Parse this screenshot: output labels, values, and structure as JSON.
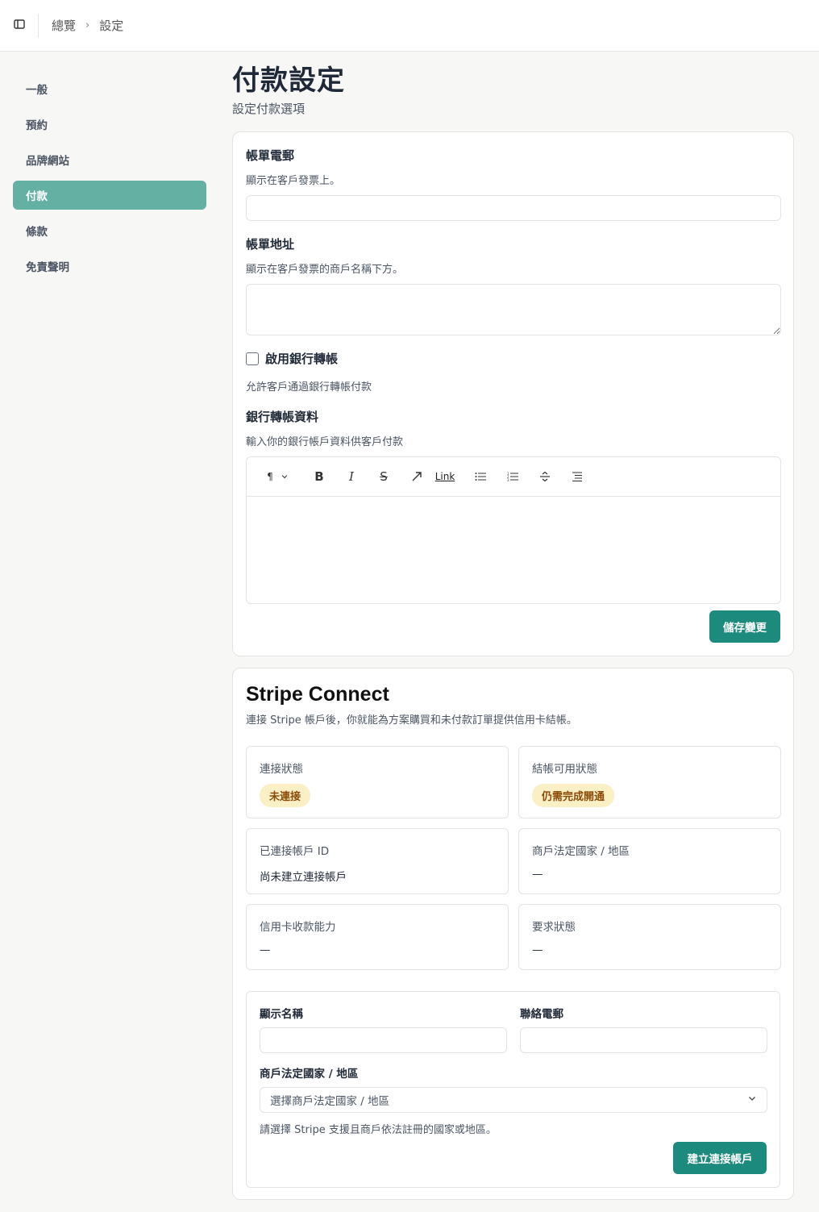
{
  "header": {
    "breadcrumb": [
      "總覽",
      "設定"
    ]
  },
  "sidebar": {
    "items": [
      {
        "label": "一般"
      },
      {
        "label": "預約"
      },
      {
        "label": "品牌網站"
      },
      {
        "label": "付款",
        "active": true
      },
      {
        "label": "條款"
      },
      {
        "label": "免責聲明"
      }
    ]
  },
  "page": {
    "title": "付款設定",
    "subtitle": "設定付款選項"
  },
  "billing": {
    "email_label": "帳單電郵",
    "email_desc": "顯示在客戶發票上。",
    "email_value": "",
    "address_label": "帳單地址",
    "address_desc": "顯示在客戶發票的商戶名稱下方。",
    "address_value": "",
    "bank_transfer_label": "啟用銀行轉帳",
    "bank_transfer_desc": "允許客戶通過銀行轉帳付款",
    "bank_transfer_checked": false,
    "bank_info_label": "銀行轉帳資料",
    "bank_info_desc": "輸入你的銀行帳戶資料供客戶付款",
    "toolbar": {
      "paragraph": "¶",
      "link": "Link",
      "icons": [
        "paragraph-icon",
        "chevron-down-icon",
        "bold-icon",
        "italic-icon",
        "strikethrough-icon",
        "link-arrow-icon",
        "bullet-list-icon",
        "ordered-list-icon",
        "divider-icon",
        "indent-icon"
      ]
    },
    "save_label": "儲存變更"
  },
  "stripe": {
    "title": "Stripe Connect",
    "desc": "連接 Stripe 帳戶後，你就能為方案購買和未付款訂單提供信用卡結帳。",
    "connection_status_label": "連接狀態",
    "connection_status": "未連接",
    "checkout_status_label": "結帳可用狀態",
    "checkout_status": "仍需完成開通",
    "account_id_label": "已連接帳戶 ID",
    "account_id": "尚未建立連接帳戶",
    "country_label": "商戶法定國家 / 地區",
    "country": "—",
    "card_capability_label": "信用卡收款能力",
    "card_capability": "—",
    "requirements_label": "要求狀態",
    "requirements": "—",
    "badge_color": "#fbefc6",
    "form": {
      "display_name_label": "顯示名稱",
      "display_name_value": "",
      "contact_email_label": "聯絡電郵",
      "contact_email_value": "",
      "country_label": "商戶法定國家 / 地區",
      "country_placeholder": "選擇商戶法定國家 / 地區",
      "country_hint": "請選擇 Stripe 支援且商戶依法註冊的國家或地區。",
      "create_label": "建立連接帳戶"
    }
  },
  "colors": {
    "accent": "#1c8a7c",
    "nav_active": "#64b1a4"
  }
}
